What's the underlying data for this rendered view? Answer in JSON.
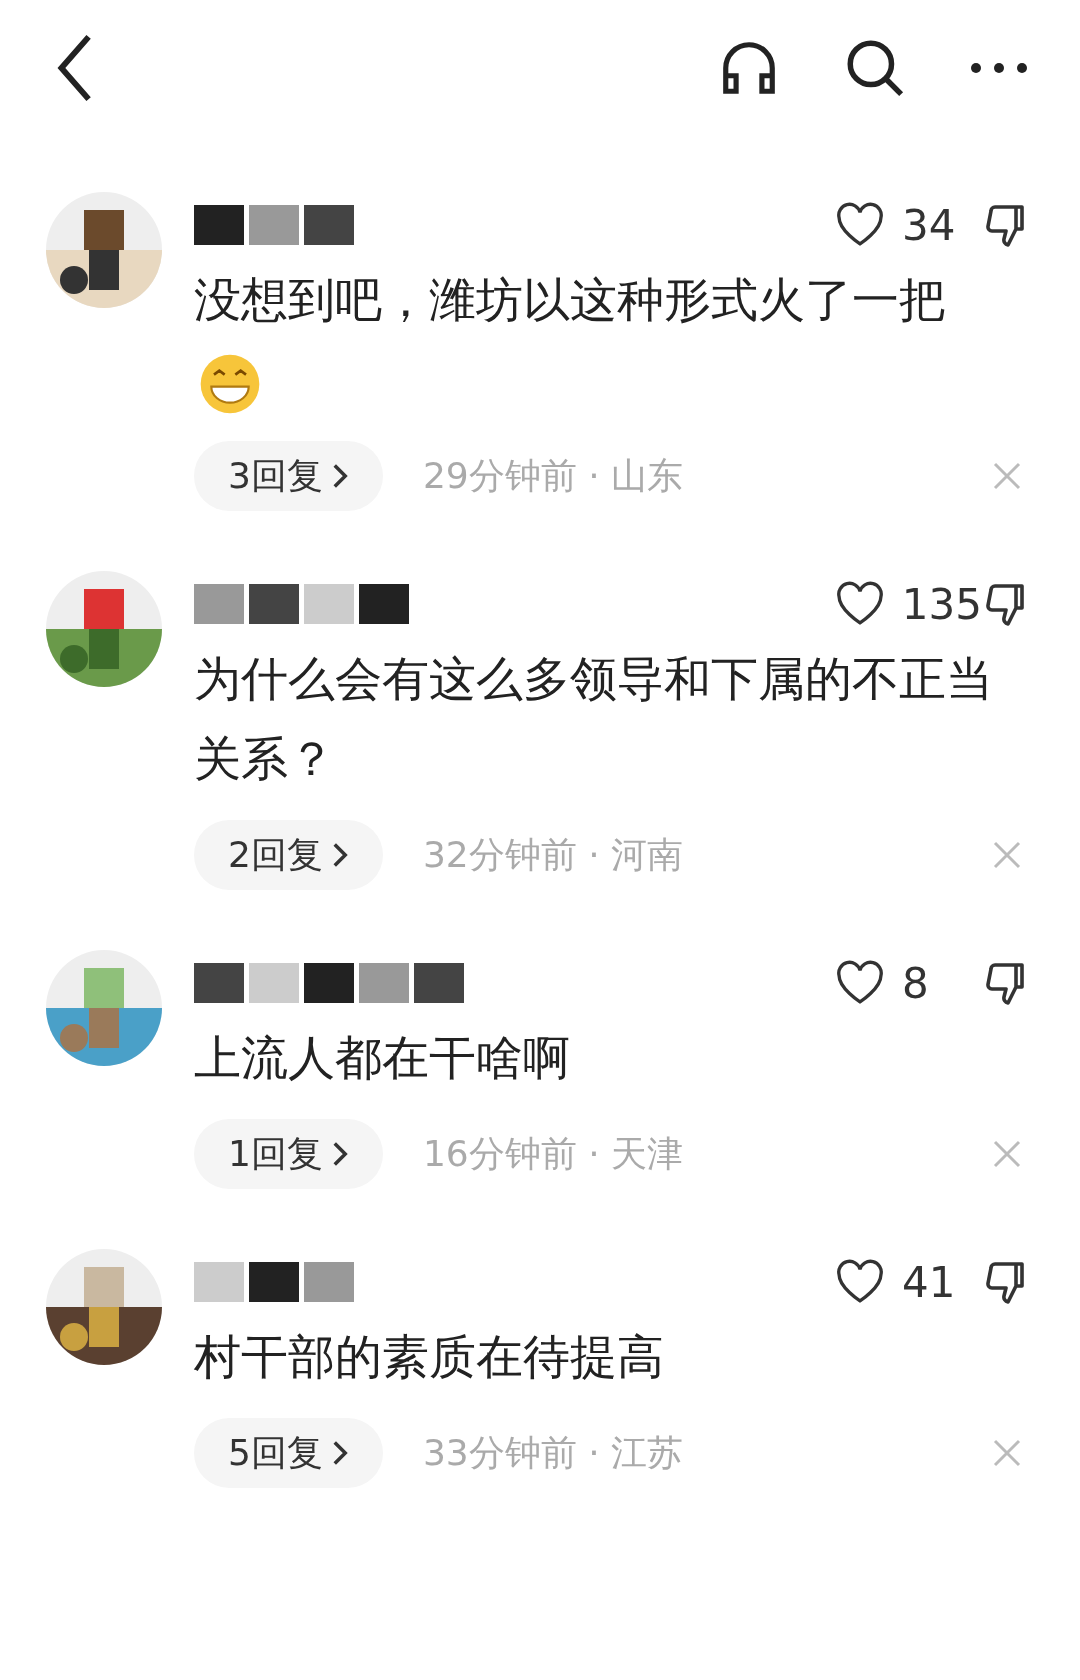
{
  "comments": [
    {
      "likes": "34",
      "text": "没想到吧，潍坊以这种形式火了一把",
      "emoji": true,
      "replies": "3回复",
      "meta": "29分钟前 · 山东"
    },
    {
      "likes": "135",
      "text": "为什么会有这么多领导和下属的不正当关系？",
      "emoji": false,
      "replies": "2回复",
      "meta": "32分钟前 · 河南"
    },
    {
      "likes": "8",
      "text": "上流人都在干啥啊",
      "emoji": false,
      "replies": "1回复",
      "meta": "16分钟前 · 天津"
    },
    {
      "likes": "41",
      "text": "村干部的素质在待提高",
      "emoji": false,
      "replies": "5回复",
      "meta": "33分钟前 · 江苏"
    }
  ]
}
